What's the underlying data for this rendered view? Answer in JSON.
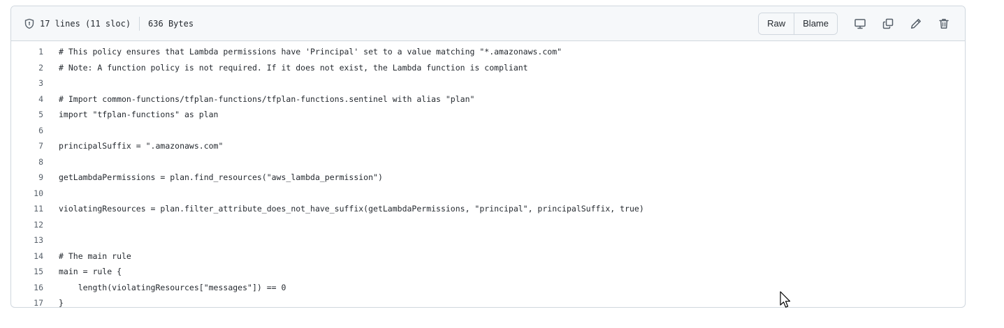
{
  "file_info": {
    "lines": "17 lines (11 sloc)",
    "size": "636 Bytes"
  },
  "actions": {
    "raw_label": "Raw",
    "blame_label": "Blame",
    "icons": [
      "desktop-icon",
      "copy-icon",
      "pencil-icon",
      "trash-icon"
    ]
  },
  "code_lines": [
    {
      "num": "1",
      "text": "# This policy ensures that Lambda permissions have 'Principal' set to a value matching \"*.amazonaws.com\""
    },
    {
      "num": "2",
      "text": "# Note: A function policy is not required. If it does not exist, the Lambda function is compliant"
    },
    {
      "num": "3",
      "text": ""
    },
    {
      "num": "4",
      "text": "# Import common-functions/tfplan-functions/tfplan-functions.sentinel with alias \"plan\""
    },
    {
      "num": "5",
      "text": "import \"tfplan-functions\" as plan"
    },
    {
      "num": "6",
      "text": ""
    },
    {
      "num": "7",
      "text": "principalSuffix = \".amazonaws.com\""
    },
    {
      "num": "8",
      "text": ""
    },
    {
      "num": "9",
      "text": "getLambdaPermissions = plan.find_resources(\"aws_lambda_permission\")"
    },
    {
      "num": "10",
      "text": ""
    },
    {
      "num": "11",
      "text": "violatingResources = plan.filter_attribute_does_not_have_suffix(getLambdaPermissions, \"principal\", principalSuffix, true)"
    },
    {
      "num": "12",
      "text": ""
    },
    {
      "num": "13",
      "text": ""
    },
    {
      "num": "14",
      "text": "# The main rule"
    },
    {
      "num": "15",
      "text": "main = rule {"
    },
    {
      "num": "16",
      "text": "    length(violatingResources[\"messages\"]) == 0"
    },
    {
      "num": "17",
      "text": "}"
    }
  ]
}
